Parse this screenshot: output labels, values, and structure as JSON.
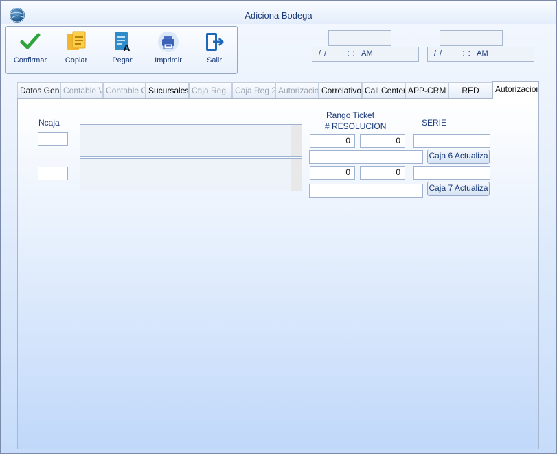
{
  "window": {
    "title": "Adiciona Bodega"
  },
  "toolbar": {
    "confirmar": "Confirmar",
    "copiar": "Copiar",
    "pegar": "Pegar",
    "imprimir": "Imprimir",
    "salir": "Salir"
  },
  "header": {
    "datetime1": "/ /      : :  AM",
    "datetime2": "/ /      : :  AM"
  },
  "tabs": [
    {
      "label": "Datos Generales",
      "state": "normal"
    },
    {
      "label": "Contable Ventas",
      "state": "disabled"
    },
    {
      "label": "Contable Compras",
      "state": "disabled"
    },
    {
      "label": "Sucursales",
      "state": "normal"
    },
    {
      "label": "Caja Reg",
      "state": "disabled"
    },
    {
      "label": "Caja Reg 2",
      "state": "disabled"
    },
    {
      "label": "Autorizaciones",
      "state": "disabled"
    },
    {
      "label": "Correlativos",
      "state": "normal"
    },
    {
      "label": "Call Center",
      "state": "normal"
    },
    {
      "label": "APP-CRM",
      "state": "normal"
    },
    {
      "label": "RED",
      "state": "normal"
    },
    {
      "label": "Autorizaciones",
      "state": "active"
    }
  ],
  "panel": {
    "ncaja_label": "Ncaja",
    "rango_label": "Rango Ticket",
    "resolucion_label": "# RESOLUCION",
    "serie_label": "SERIE",
    "row1": {
      "desde": "0",
      "hasta": "0",
      "button": "Caja 6 Actualiza"
    },
    "row2": {
      "desde": "0",
      "hasta": "0",
      "button": "Caja 7 Actualiza"
    }
  }
}
